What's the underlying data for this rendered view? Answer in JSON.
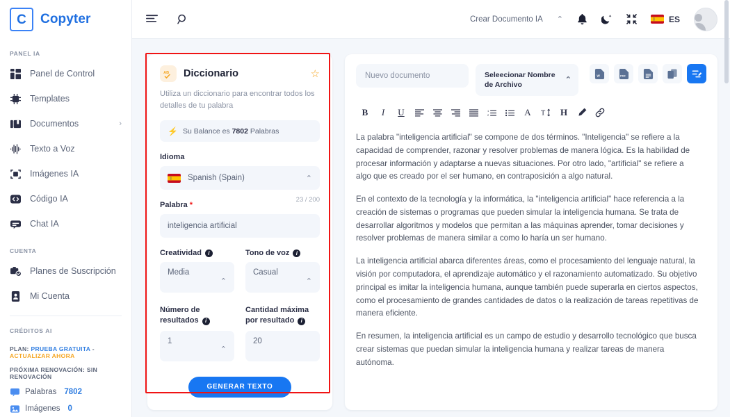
{
  "brand": {
    "mark": "C",
    "name": "Copyter"
  },
  "sidebar": {
    "section_panel": "PANEL IA",
    "items": [
      {
        "label": "Panel de Control",
        "icon": "dashboard-icon"
      },
      {
        "label": "Templates",
        "icon": "chip-ai-icon"
      },
      {
        "label": "Documentos",
        "icon": "documents-icon",
        "chevron": "›"
      },
      {
        "label": "Texto a Voz",
        "icon": "waveform-icon"
      },
      {
        "label": "Imágenes IA",
        "icon": "image-frame-icon"
      },
      {
        "label": "Código IA",
        "icon": "code-icon"
      },
      {
        "label": "Chat IA",
        "icon": "chat-icon"
      }
    ],
    "section_account": "CUENTA",
    "account_items": [
      {
        "label": "Planes de Suscripción",
        "icon": "subscription-icon"
      },
      {
        "label": "Mi Cuenta",
        "icon": "id-card-icon"
      }
    ],
    "section_credits": "CRÉDITOS AI",
    "plan_prefix": "PLAN:",
    "plan_value": "PRUEBA GRATUITA",
    "plan_sep": "-",
    "plan_upgrade": "ACTUALIZAR AHORA",
    "renewal": "PRÓXIMA RENOVACIÓN: SIN RENOVACIÓN",
    "meters": [
      {
        "label": "Palabras",
        "value": "7802",
        "icon": "word-bubble-icon"
      },
      {
        "label": "Imágenes",
        "value": "0",
        "icon": "image-icon"
      }
    ]
  },
  "topbar": {
    "menu_icon": "menu-align-icon",
    "search_icon": "search-icon",
    "create_document": "Crear Documento IA",
    "caret": "⌃",
    "bell_icon": "bell-icon",
    "moon_icon": "dark-mode-icon",
    "compress_icon": "fullscreen-exit-icon",
    "language": "ES",
    "avatar": "user-avatar"
  },
  "form": {
    "badge_icon": "spellcheck-icon",
    "title": "Diccionario",
    "star": "☆",
    "description": "Utiliza un diccionario para encontrar todos los detalles de tu palabra",
    "balance_prefix": "Su Balance es",
    "balance_value": "7802",
    "balance_suffix": "Palabras",
    "language_label": "Idioma",
    "language_value": "Spanish (Spain)",
    "word_label": "Palabra",
    "word_required": "*",
    "word_counter": "23 / 200",
    "word_value": "inteligencia artificial",
    "creativity_label": "Creatividad",
    "creativity_value": "Media",
    "tone_label": "Tono de voz",
    "tone_value": "Casual",
    "results_label": "Número de resultados",
    "results_value": "1",
    "max_label": "Cantidad máxima por resultado",
    "max_value": "20",
    "generate_button": "GENERAR TEXTO",
    "highlight_color": "#f01414"
  },
  "editor": {
    "doc_name_placeholder": "Nuevo documento",
    "file_select_label": "Seleecionar Nombre de Archivo",
    "export_buttons": [
      {
        "name": "export-word-button",
        "label": "W"
      },
      {
        "name": "export-pdf-button",
        "label": "PDF"
      },
      {
        "name": "export-text-button",
        "label": "TXT"
      },
      {
        "name": "copy-button",
        "label": "COPY"
      },
      {
        "name": "save-document-button",
        "label": "SAVE"
      }
    ],
    "format_tools": [
      "bold",
      "italic",
      "underline",
      "align-left",
      "align-center",
      "align-right",
      "align-justify",
      "ordered-list",
      "unordered-list",
      "font-color",
      "font-size",
      "heading",
      "highlighter",
      "link"
    ],
    "paragraphs": [
      "La palabra \"inteligencia artificial\" se compone de dos términos. \"Inteligencia\" se refiere a la capacidad de comprender, razonar y resolver problemas de manera lógica. Es la habilidad de procesar información y adaptarse a nuevas situaciones. Por otro lado, \"artificial\" se refiere a algo que es creado por el ser humano, en contraposición a algo natural.",
      "En el contexto de la tecnología y la informática, la \"inteligencia artificial\" hace referencia a la creación de sistemas o programas que pueden simular la inteligencia humana. Se trata de desarrollar algoritmos y modelos que permitan a las máquinas aprender, tomar decisiones y resolver problemas de manera similar a como lo haría un ser humano.",
      "La inteligencia artificial abarca diferentes áreas, como el procesamiento del lenguaje natural, la visión por computadora, el aprendizaje automático y el razonamiento automatizado. Su objetivo principal es imitar la inteligencia humana, aunque también puede superarla en ciertos aspectos, como el procesamiento de grandes cantidades de datos o la realización de tareas repetitivas de manera eficiente.",
      "En resumen, la inteligencia artificial es un campo de estudio y desarrollo tecnológico que busca crear sistemas que puedan simular la inteligencia humana y realizar tareas de manera autónoma."
    ]
  },
  "colors": {
    "accent": "#1877f2",
    "brand": "#1f6fe0",
    "orange": "#f5a623",
    "bg": "#f4f7fb"
  }
}
